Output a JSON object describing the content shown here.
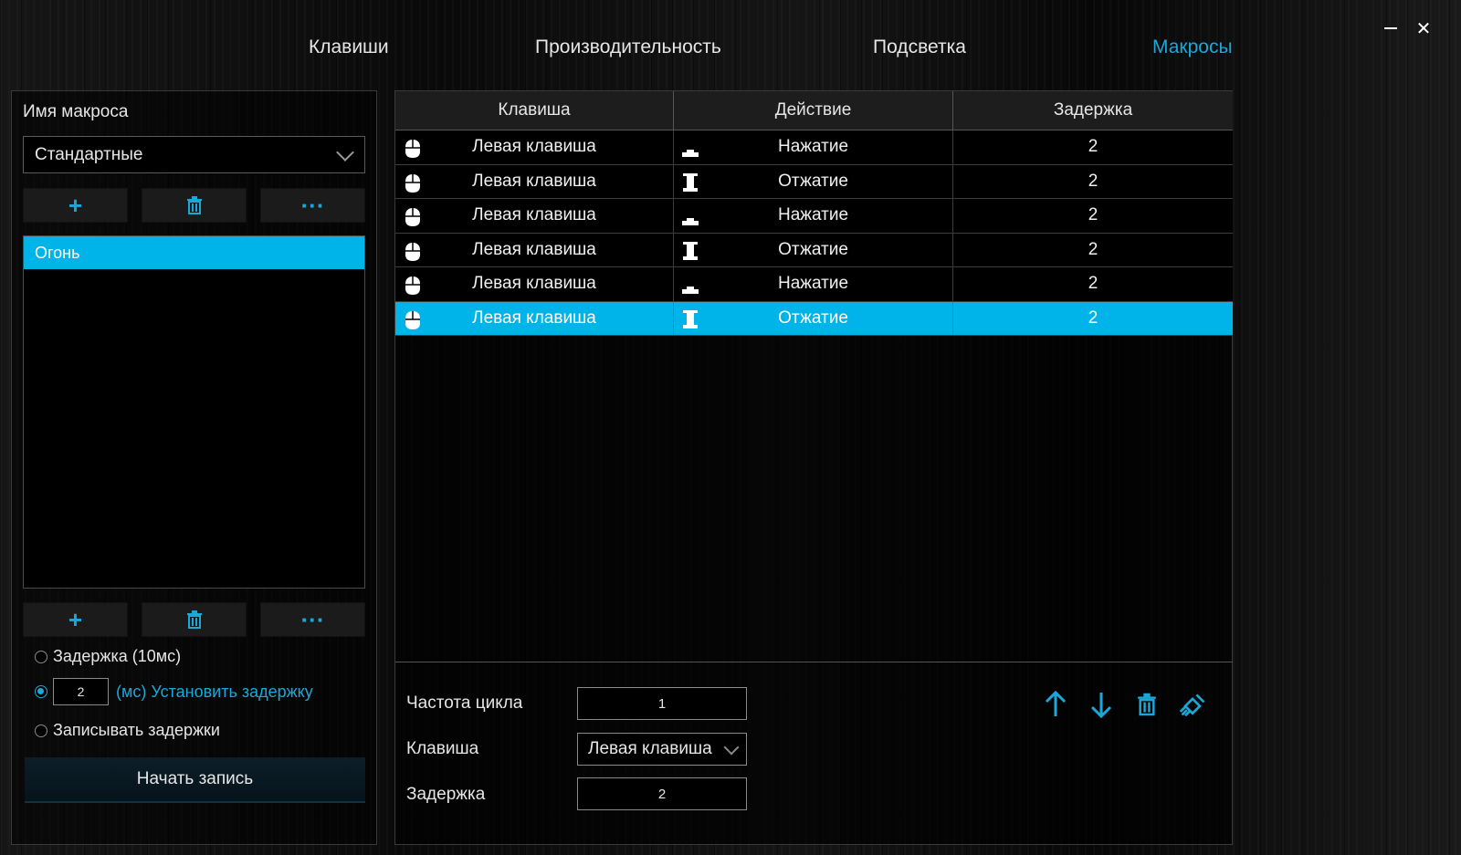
{
  "window": {
    "minimize_icon": "minimize-icon",
    "close_icon": "close-icon",
    "close_glyph": "✕"
  },
  "tabs": [
    {
      "label": "Клавиши",
      "active": false
    },
    {
      "label": "Производительность",
      "active": false
    },
    {
      "label": "Подсветка",
      "active": false
    },
    {
      "label": "Макросы",
      "active": true
    }
  ],
  "colors": {
    "accent": "#1ba8d8",
    "selection": "#00b4ea"
  },
  "left_panel": {
    "title": "Имя макроса",
    "group_dropdown": {
      "value": "Стандартные"
    },
    "group_buttons": {
      "add": "+",
      "delete_icon": "trash-icon",
      "more": "···"
    },
    "macros": [
      {
        "name": "Огонь",
        "selected": true
      }
    ],
    "macro_buttons": {
      "add": "+",
      "delete_icon": "trash-icon",
      "more": "···"
    },
    "delay_options": {
      "fixed": "Задержка (10мс)",
      "custom_value": "2",
      "custom_label": "(мс) Установить задержку",
      "record": "Записывать задержки",
      "selected": "custom"
    },
    "record_button": "Начать запись"
  },
  "table": {
    "headers": [
      "Клавиша",
      "Действие",
      "Задержка"
    ],
    "rows": [
      {
        "key_icon": "mouse-icon",
        "key": "Левая клавиша",
        "action_icon": "key-press-icon",
        "action": "Нажатие",
        "delay": "2",
        "selected": false
      },
      {
        "key_icon": "mouse-icon",
        "key": "Левая клавиша",
        "action_icon": "key-release-icon",
        "action": "Отжатие",
        "delay": "2",
        "selected": false
      },
      {
        "key_icon": "mouse-icon",
        "key": "Левая клавиша",
        "action_icon": "key-press-icon",
        "action": "Нажатие",
        "delay": "2",
        "selected": false
      },
      {
        "key_icon": "mouse-icon",
        "key": "Левая клавиша",
        "action_icon": "key-release-icon",
        "action": "Отжатие",
        "delay": "2",
        "selected": false
      },
      {
        "key_icon": "mouse-icon",
        "key": "Левая клавиша",
        "action_icon": "key-press-icon",
        "action": "Нажатие",
        "delay": "2",
        "selected": false
      },
      {
        "key_icon": "mouse-icon",
        "key": "Левая клавиша",
        "action_icon": "key-release-icon",
        "action": "Отжатие",
        "delay": "2",
        "selected": true
      }
    ]
  },
  "editor": {
    "cycle_label": "Частота цикла",
    "cycle_value": "1",
    "key_label": "Клавиша",
    "key_value": "Левая клавиша",
    "delay_label": "Задержка",
    "delay_value": "2",
    "action_icons": [
      "arrow-up-icon",
      "arrow-down-icon",
      "trash-icon",
      "clear-icon"
    ]
  }
}
